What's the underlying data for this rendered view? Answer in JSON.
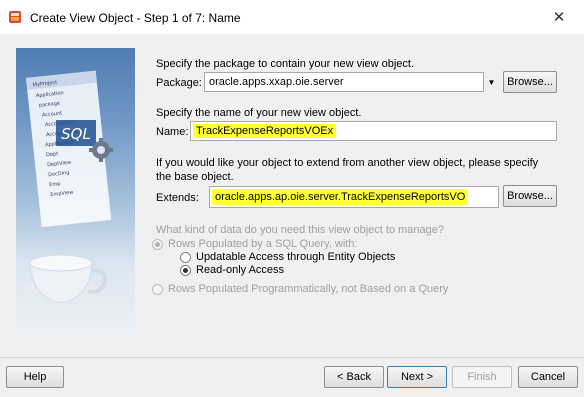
{
  "window": {
    "title": "Create View Object - Step 1 of 7: Name",
    "close_label": "✕"
  },
  "package": {
    "prompt": "Specify the package to contain your new view object.",
    "label": "Package:",
    "value": "oracle.apps.xxap.oie.server",
    "browse_label": "Browse..."
  },
  "name": {
    "prompt": "Specify the name of your new view object.",
    "label": "Name:",
    "value": "TrackExpenseReportsVOEx"
  },
  "extends": {
    "prompt_line1": "If you would like your object to extend from another view object, please specify",
    "prompt_line2": "the base object.",
    "label": "Extends:",
    "value": "oracle.apps.ap.oie.server.TrackExpenseReportsVO",
    "browse_label": "Browse..."
  },
  "data_source": {
    "question": "What kind of data do you need this view object to manage?",
    "options": [
      {
        "label": "Rows Populated by a SQL Query, with:",
        "checked": true,
        "disabled": true
      },
      {
        "label": "Updatable Access through Entity Objects",
        "checked": false,
        "disabled": false
      },
      {
        "label": "Read-only Access",
        "checked": true,
        "disabled": false
      },
      {
        "label": "Rows Populated Programmatically, not Based on a Query",
        "checked": false,
        "disabled": true
      }
    ]
  },
  "footer": {
    "help": "Help",
    "back": "< Back",
    "next": "Next >",
    "finish": "Finish",
    "cancel": "Cancel"
  },
  "side_image": {
    "badge_text": "SQL",
    "tree_items": [
      "MyProject",
      "Application",
      "package",
      "Account",
      "AccountUser",
      "AccountView",
      "AppModule",
      "Dept",
      "DeptView",
      "DocDing",
      "Emp",
      "EmpView"
    ]
  },
  "colors": {
    "highlight": "#ffff33",
    "side_image_top": "#4f7db2",
    "dialog_bg": "#f0f0f0"
  },
  "icons": [
    "app-icon",
    "close-icon",
    "combo-arrow-icon",
    "gear-icon"
  ]
}
